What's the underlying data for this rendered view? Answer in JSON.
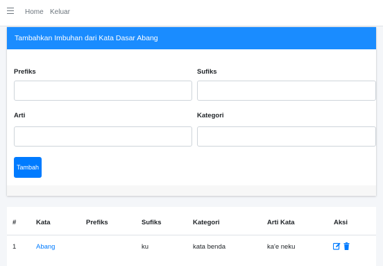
{
  "nav": {
    "menu_icon": "hamburger-icon",
    "links": [
      "Home",
      "Keluar"
    ]
  },
  "form": {
    "title": "Tambahkan Imbuhan dari Kata Dasar Abang",
    "fields": {
      "prefiks": {
        "label": "Prefiks",
        "value": ""
      },
      "sufiks": {
        "label": "Sufiks",
        "value": ""
      },
      "arti": {
        "label": "Arti",
        "value": ""
      },
      "kategori": {
        "label": "Kategori",
        "value": ""
      }
    },
    "submit_label": "Tambah"
  },
  "table": {
    "headers": [
      "#",
      "Kata",
      "Prefiks",
      "Sufiks",
      "Kategori",
      "Arti Kata",
      "Aksi"
    ],
    "rows": [
      {
        "no": "1",
        "kata": "Abang",
        "prefiks": "",
        "sufiks": "ku",
        "kategori": "kata benda",
        "arti": "ka'e neku"
      }
    ],
    "action_icons": [
      "edit-icon",
      "trash-icon"
    ]
  },
  "colors": {
    "header_bg": "#1a8cff",
    "button": "#007bff",
    "link": "#007bff"
  }
}
